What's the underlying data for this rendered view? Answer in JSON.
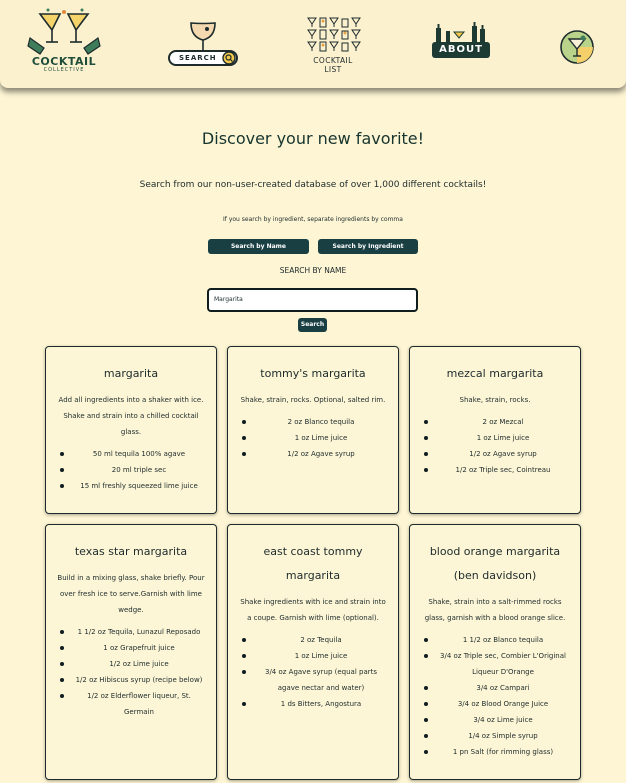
{
  "header": {
    "logo_word": "COCKTAIL",
    "logo_sub": "COLLECTIVE",
    "search_label": "SEARCH",
    "list_label": "COCKTAIL LIST",
    "about_label": "ABOUT"
  },
  "hero": {
    "title": "Discover your new favorite!",
    "subtitle": "Search from our non-user-created database of over 1,000 different cocktails!",
    "hint": "If you search by ingredient, separate ingredients by comma"
  },
  "search": {
    "by_name_label": "Search by Name",
    "by_ingredient_label": "Search by Ingredient",
    "mode_label": "SEARCH BY NAME",
    "query": "Margarita",
    "button_label": "Search"
  },
  "colors": {
    "background": "#fdf5d3",
    "accent": "#1a3f43",
    "text": "#1d2b2c"
  },
  "cards": [
    {
      "title": "margarita",
      "description": "Add all ingredients into a shaker with ice. Shake and strain into a chilled cocktail glass.",
      "ingredients": [
        "50 ml tequila 100% agave",
        "20 ml triple sec",
        "15 ml freshly squeezed lime juice"
      ]
    },
    {
      "title": "tommy's margarita",
      "description": "Shake, strain, rocks. Optional, salted rim.",
      "ingredients": [
        "2 oz Blanco tequila",
        "1 oz Lime juice",
        "1/2 oz Agave syrup"
      ]
    },
    {
      "title": "mezcal margarita",
      "description": "Shake, strain, rocks.",
      "ingredients": [
        "2 oz Mezcal",
        "1 oz Lime juice",
        "1/2 oz Agave syrup",
        "1/2 oz Triple sec, Cointreau"
      ]
    },
    {
      "title": "texas star margarita",
      "description": "Build in a mixing glass, shake briefly. Pour over fresh ice to serve.Garnish with lime wedge.",
      "ingredients": [
        "1 1/2 oz Tequila, Lunazul Reposado",
        "1 oz Grapefruit juice",
        "1/2 oz Lime juice",
        "1/2 oz Hibiscus syrup (recipe below)",
        "1/2 oz Elderflower liqueur, St. Germain"
      ]
    },
    {
      "title": "east coast tommy margarita",
      "description": "Shake ingredients with ice and strain into a coupe. Garnish with lime (optional).",
      "ingredients": [
        "2 oz Tequila",
        "1 oz Lime juice",
        "3/4 oz Agave syrup (equal parts agave nectar and water)",
        "1 ds Bitters, Angostura"
      ]
    },
    {
      "title": "blood orange margarita (ben davidson)",
      "description": "Shake, strain into a salt-rimmed rocks glass, garnish with a blood orange slice.",
      "ingredients": [
        "1 1/2 oz Blanco tequila",
        "3/4 oz Triple sec, Combier L'Original Liqueur D'Orange",
        "3/4 oz Campari",
        "3/4 oz Blood Orange Juice",
        "3/4 oz Lime juice",
        "1/4 oz Simple syrup",
        "1 pn Salt (for rimming glass)"
      ]
    }
  ]
}
